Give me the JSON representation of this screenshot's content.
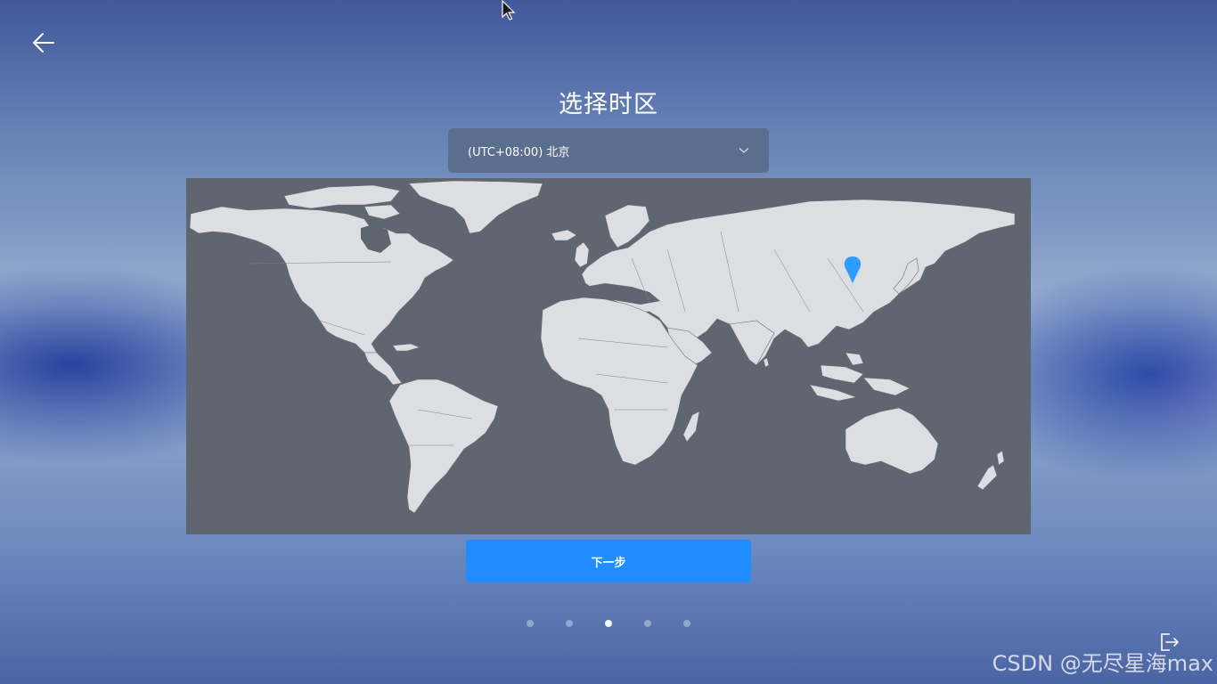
{
  "page": {
    "title": "选择时区"
  },
  "timezone": {
    "selected": "(UTC+08:00) 北京"
  },
  "map": {
    "marker_city": "北京"
  },
  "buttons": {
    "next_label": "下一步"
  },
  "pagination": {
    "total": 5,
    "current": 3
  },
  "watermark": "CSDN @无尽星海max",
  "icons": {
    "back": "back-arrow-icon",
    "dropdown": "chevron-down-icon",
    "location": "location-pin-icon",
    "exit": "exit-icon",
    "cursor": "mouse-cursor-icon"
  },
  "colors": {
    "accent": "#1f8cff",
    "marker": "#2e9bff",
    "map_ocean": "#5f6670",
    "map_land": "#dcdee2",
    "select_bg": "#5b6e8e"
  }
}
